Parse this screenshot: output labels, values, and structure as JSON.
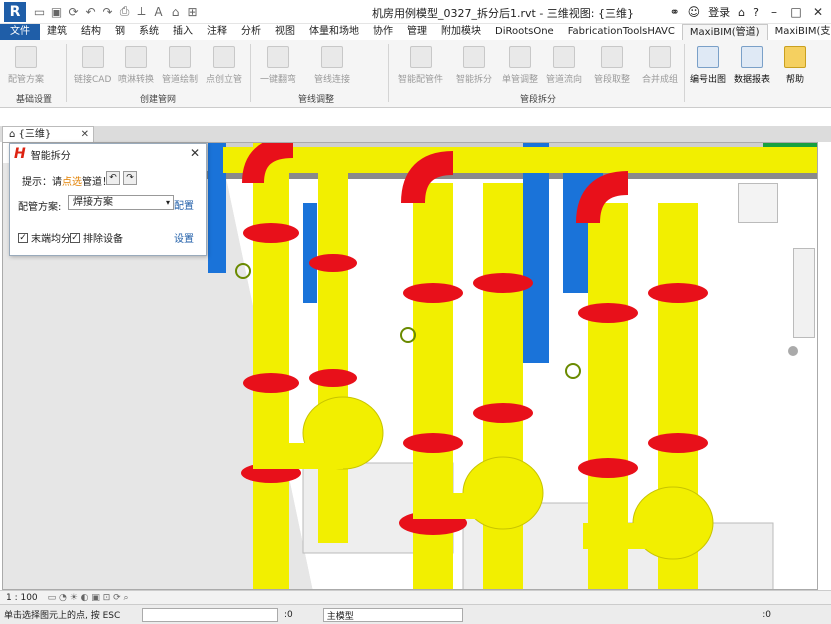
{
  "titlebar": {
    "title": "机房用例模型_0327_拆分后1.rvt - 三维视图: {三维}",
    "user": "登录",
    "app_logo": "R"
  },
  "tabs": [
    "文件",
    "建筑",
    "结构",
    "钢",
    "系统",
    "插入",
    "注释",
    "分析",
    "视图",
    "体量和场地",
    "协作",
    "管理",
    "附加模块",
    "DiRootsOne",
    "FabricationToolsHAVC",
    "MaxiBIM(管道)",
    "MaxiBIM(支吊架)"
  ],
  "active_tab": "MaxiBIM(管道)",
  "ribbon": {
    "groups": [
      {
        "label": "基础设置",
        "buttons": [
          "配管方案"
        ]
      },
      {
        "label": "创建管网",
        "buttons": [
          "链接CAD",
          "喷淋转换",
          "管道绘制",
          "点创立管"
        ]
      },
      {
        "label": "管线调整",
        "buttons": [
          "一键翻弯",
          "管线连接"
        ]
      },
      {
        "label": "管段拆分",
        "buttons": [
          "智能配管件",
          "智能拆分",
          "单管调整",
          "管道流向",
          "管段取整",
          "合并成组"
        ]
      }
    ],
    "enabled_buttons": [
      "编号出图",
      "数据报表",
      "帮助"
    ]
  },
  "view_tab": {
    "label": "{三维}"
  },
  "panel": {
    "title": "智能拆分",
    "hint_prefix": "提示：请",
    "hint_highlight": "点选",
    "hint_suffix": "管道！",
    "scheme_label": "配管方案:",
    "scheme_value": "焊接方案",
    "config_link": "配置",
    "settings_link": "设置",
    "check1": "末端均分",
    "check2": "排除设备"
  },
  "view_controls": {
    "scale": "1 : 100"
  },
  "status": {
    "text": "单击选择图元上的点, 按 ESC",
    "sel_count": ":0",
    "model": "主模型",
    "filter_count": ":0"
  },
  "colors": {
    "pipe": "#f2ef00",
    "flange": "#e8101a",
    "blue_pipe": "#1a73d9",
    "accent": "#1f5ea8"
  }
}
